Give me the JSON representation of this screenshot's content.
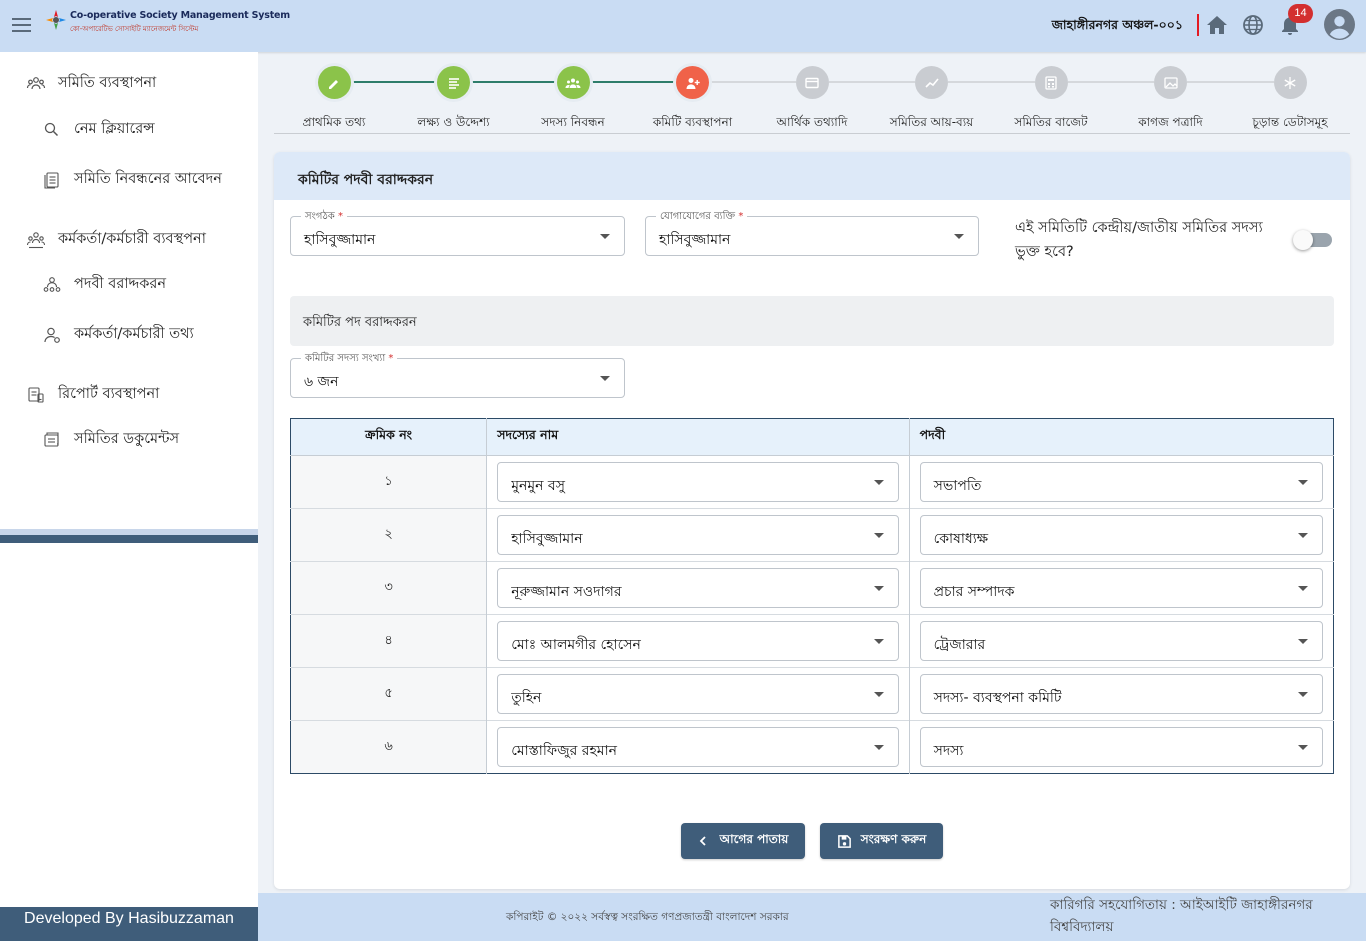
{
  "header": {
    "app_title_en": "Co-operative Society Management System",
    "app_title_bn": "কো-অপারেটিভ সোসাইটি ম্যানেজমেন্ট সিস্টেম",
    "office": "জাহাঙ্গীরনগর অঞ্চল-০০১",
    "notification_count": "14",
    "icons": [
      "menu-icon",
      "home-icon",
      "globe-icon",
      "bell-icon",
      "user-avatar-icon"
    ]
  },
  "sidebar": {
    "items": [
      {
        "label": "সমিতি ব্যবস্থাপনা",
        "icon": "society-group-icon"
      },
      {
        "label": "নেম ক্লিয়ারেন্স",
        "icon": "search-icon"
      },
      {
        "label": "সমিতি নিবন্ধনের আবেদন",
        "icon": "documents-icon"
      },
      {
        "label": "কর্মকর্তা/কর্মচারী ব্যবস্থপনা",
        "icon": "staff-group-icon"
      },
      {
        "label": "পদবী বরাদ্দকরন",
        "icon": "designation-icon"
      },
      {
        "label": "কর্মকর্তা/কর্মচারী তথ্য",
        "icon": "person-icon"
      },
      {
        "label": "রিপোর্ট ব্যবস্থাপনা",
        "icon": "report-icon"
      },
      {
        "label": "সমিতির ডকুমেন্টস",
        "icon": "folder-icon"
      }
    ],
    "developed_by": "Developed By Hasibuzzaman"
  },
  "stepper": {
    "steps": [
      {
        "label": "প্রাথমিক তথ্য",
        "icon": "pencil-icon",
        "state": "done",
        "color": "#8bc34a"
      },
      {
        "label": "লক্ষ্য ও উদ্দেশ্য",
        "icon": "list-icon",
        "state": "done",
        "color": "#8bc34a"
      },
      {
        "label": "সদস্য নিবন্ধন",
        "icon": "group-icon",
        "state": "done",
        "color": "#8bc34a"
      },
      {
        "label": "কমিটি ব্যবস্থাপনা",
        "icon": "add-person-icon",
        "state": "active",
        "color": "#f06249"
      },
      {
        "label": "আর্থিক তথ্যাদি",
        "icon": "card-icon",
        "state": "pending",
        "color": "#c9ccd1"
      },
      {
        "label": "সমিতির আয়-ব্যয়",
        "icon": "chart-icon",
        "state": "pending",
        "color": "#c9ccd1"
      },
      {
        "label": "সমিতির বাজেট",
        "icon": "calculator-icon",
        "state": "pending",
        "color": "#c9ccd1"
      },
      {
        "label": "কাগজ পত্রাদি",
        "icon": "image-icon",
        "state": "pending",
        "color": "#c9ccd1"
      },
      {
        "label": "চূড়ান্ত ডেটাসমূহ",
        "icon": "snowflake-icon",
        "state": "pending",
        "color": "#c9ccd1"
      }
    ],
    "done_line_color": "#2e7d6a"
  },
  "form": {
    "title": "কমিটির পদবী বরাদ্দকরন",
    "organizer": {
      "label": "সংগঠক",
      "required": "*",
      "value": "হাসিবুজ্জামান"
    },
    "contact_person": {
      "label": "যোগাযোগের ব্যক্তি",
      "required": "*",
      "value": "হাসিবুজ্জামান"
    },
    "central_membership_question": "এই সমিতিটি কেন্দ্রীয়/জাতীয় সমিতির সদস্য ভুক্ত হবে?",
    "central_membership_toggle": false,
    "section_title": "কমিটির পদ বরাদ্দকরন",
    "member_count": {
      "label": "কমিটির সদস্য সংখ্যা",
      "required": "*",
      "value": "৬ জন"
    },
    "table": {
      "headers": [
        "ক্রমিক নং",
        "সদস্যের নাম",
        "পদবী"
      ],
      "rows": [
        {
          "serial": "১",
          "member": "মুনমুন বসু",
          "designation": "সভাপতি"
        },
        {
          "serial": "২",
          "member": "হাসিবুজ্জামান",
          "designation": "কোষাধ্যক্ষ"
        },
        {
          "serial": "৩",
          "member": "নূরুজ্জামান সওদাগর",
          "designation": "প্রচার সম্পাদক"
        },
        {
          "serial": "৪",
          "member": "মোঃ আলমগীর হোসেন",
          "designation": "ট্রেজারার"
        },
        {
          "serial": "৫",
          "member": "তুহিন",
          "designation": "সদস্য- ব্যবস্থপনা কমিটি"
        },
        {
          "serial": "৬",
          "member": "মোস্তাফিজুর রহমান",
          "designation": "সদস্য"
        }
      ]
    },
    "back_button": "আগের পাতায়",
    "save_button": "সংরক্ষণ করুন"
  },
  "footer": {
    "copyright": "কপিরাইট © ২০২২ সর্বস্বত্ব সংরক্ষিত গণপ্রজাতন্ত্রী বাংলাদেশ সরকার",
    "tech_support": "কারিগরি সহযোগিতায় : আইআইটি জাহাঙ্গীরনগর বিশ্ববিদ্যালয়"
  },
  "colors": {
    "topbar": "#c9dcf3",
    "primary_button": "#3f5d7a",
    "done_step": "#8bc34a",
    "active_step": "#f06249"
  }
}
